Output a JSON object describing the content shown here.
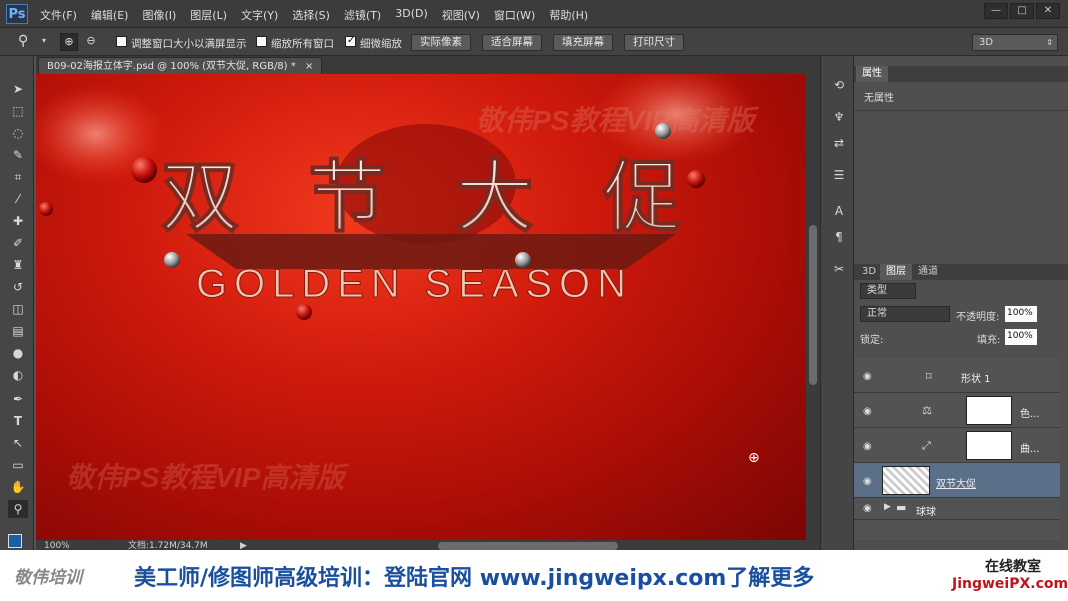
{
  "app": {
    "logo": "Ps"
  },
  "menu": [
    "文件(F)",
    "编辑(E)",
    "图像(I)",
    "图层(L)",
    "文字(Y)",
    "选择(S)",
    "滤镜(T)",
    "3D(D)",
    "视图(V)",
    "窗口(W)",
    "帮助(H)"
  ],
  "window_controls": [
    "—",
    "□",
    "✕"
  ],
  "options": {
    "fit_window_label": "调整窗口大小以满屏显示",
    "zoom_all_label": "缩放所有窗口",
    "scrubby_label": "细微缩放",
    "btn_actual": "实际像素",
    "btn_fit": "适合屏幕",
    "btn_fill": "填充屏幕",
    "btn_print": "打印尺寸",
    "workspace": "3D"
  },
  "document": {
    "tab_title": "B09-02海报立体字.psd @ 100% (双节大促, RGB/8) *",
    "close": "×",
    "zoom": "100%",
    "doc_size": "文档:1.72M/34.7M"
  },
  "canvas": {
    "title_cn": "双节大促",
    "title_en": "GOLDEN SEASON",
    "watermark": "敬伟PS教程VIP高清版"
  },
  "properties": {
    "tab": "属性",
    "empty": "无属性"
  },
  "layers_panel": {
    "tabs": [
      "3D",
      "图层",
      "通道"
    ],
    "filter_kind": "类型",
    "blend_mode": "正常",
    "opacity_label": "不透明度:",
    "opacity": "100%",
    "lock_label": "锁定:",
    "fill_label": "填充:",
    "fill": "100%",
    "layers": [
      {
        "name": "形状 1"
      },
      {
        "name": "色..."
      },
      {
        "name": "曲..."
      },
      {
        "name": "双节大促"
      },
      {
        "name": "球球"
      }
    ]
  },
  "footer": {
    "brand_left": "敬伟培训",
    "promo": "美工师/修图师高级培训：登陆官网 www.jingweipx.com了解更多",
    "online": "在线教室",
    "site": "JingweiPX.com"
  },
  "colors": {
    "accent": "#1a5fa8",
    "selected_layer": "#5b7088",
    "canvas_red": "#d01a0c"
  }
}
